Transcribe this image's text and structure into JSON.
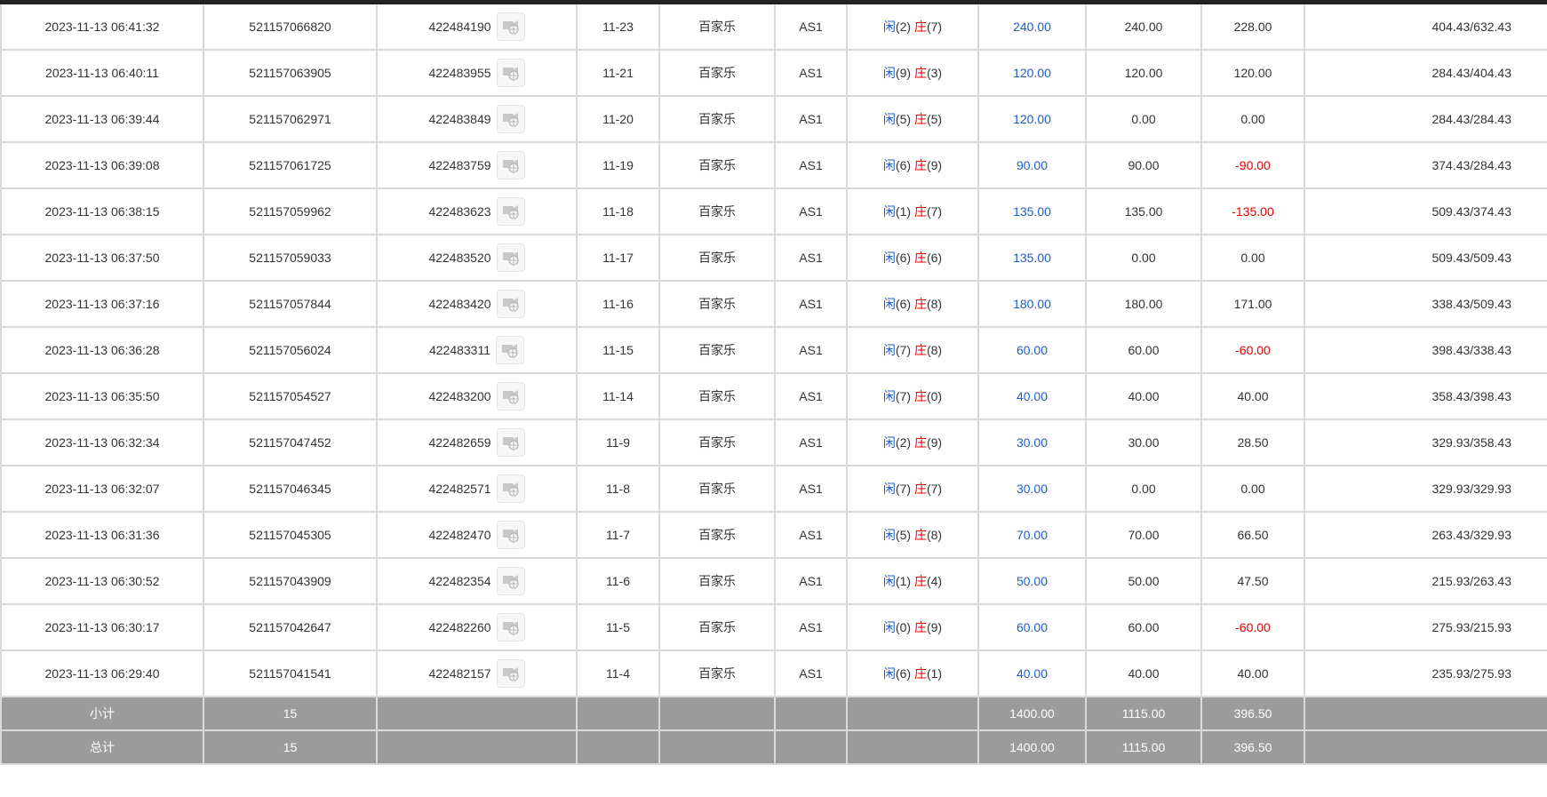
{
  "colors": {
    "bet_blue": "#1e5fc8",
    "loss_red": "#e60000",
    "footer_gray": "#9b9b9b"
  },
  "icons": {
    "video": "video-replay-icon"
  },
  "table": {
    "rows": [
      {
        "time": "2023-11-13 06:41:32",
        "order_no": "521157066820",
        "round_no": "422484190",
        "shoe": "11-23",
        "game": "百家乐",
        "table": "AS1",
        "player_label": "闲",
        "player_pts": "(2)",
        "banker_label": "庄",
        "banker_pts": "(7)",
        "bet": "240.00",
        "valid_bet": "240.00",
        "win_loss": "228.00",
        "win_loss_negative": false,
        "balance": "404.43/632.43"
      },
      {
        "time": "2023-11-13 06:40:11",
        "order_no": "521157063905",
        "round_no": "422483955",
        "shoe": "11-21",
        "game": "百家乐",
        "table": "AS1",
        "player_label": "闲",
        "player_pts": "(9)",
        "banker_label": "庄",
        "banker_pts": "(3)",
        "bet": "120.00",
        "valid_bet": "120.00",
        "win_loss": "120.00",
        "win_loss_negative": false,
        "balance": "284.43/404.43"
      },
      {
        "time": "2023-11-13 06:39:44",
        "order_no": "521157062971",
        "round_no": "422483849",
        "shoe": "11-20",
        "game": "百家乐",
        "table": "AS1",
        "player_label": "闲",
        "player_pts": "(5)",
        "banker_label": "庄",
        "banker_pts": "(5)",
        "bet": "120.00",
        "valid_bet": "0.00",
        "win_loss": "0.00",
        "win_loss_negative": false,
        "balance": "284.43/284.43"
      },
      {
        "time": "2023-11-13 06:39:08",
        "order_no": "521157061725",
        "round_no": "422483759",
        "shoe": "11-19",
        "game": "百家乐",
        "table": "AS1",
        "player_label": "闲",
        "player_pts": "(6)",
        "banker_label": "庄",
        "banker_pts": "(9)",
        "bet": "90.00",
        "valid_bet": "90.00",
        "win_loss": "-90.00",
        "win_loss_negative": true,
        "balance": "374.43/284.43"
      },
      {
        "time": "2023-11-13 06:38:15",
        "order_no": "521157059962",
        "round_no": "422483623",
        "shoe": "11-18",
        "game": "百家乐",
        "table": "AS1",
        "player_label": "闲",
        "player_pts": "(1)",
        "banker_label": "庄",
        "banker_pts": "(7)",
        "bet": "135.00",
        "valid_bet": "135.00",
        "win_loss": "-135.00",
        "win_loss_negative": true,
        "balance": "509.43/374.43"
      },
      {
        "time": "2023-11-13 06:37:50",
        "order_no": "521157059033",
        "round_no": "422483520",
        "shoe": "11-17",
        "game": "百家乐",
        "table": "AS1",
        "player_label": "闲",
        "player_pts": "(6)",
        "banker_label": "庄",
        "banker_pts": "(6)",
        "bet": "135.00",
        "valid_bet": "0.00",
        "win_loss": "0.00",
        "win_loss_negative": false,
        "balance": "509.43/509.43"
      },
      {
        "time": "2023-11-13 06:37:16",
        "order_no": "521157057844",
        "round_no": "422483420",
        "shoe": "11-16",
        "game": "百家乐",
        "table": "AS1",
        "player_label": "闲",
        "player_pts": "(6)",
        "banker_label": "庄",
        "banker_pts": "(8)",
        "bet": "180.00",
        "valid_bet": "180.00",
        "win_loss": "171.00",
        "win_loss_negative": false,
        "balance": "338.43/509.43"
      },
      {
        "time": "2023-11-13 06:36:28",
        "order_no": "521157056024",
        "round_no": "422483311",
        "shoe": "11-15",
        "game": "百家乐",
        "table": "AS1",
        "player_label": "闲",
        "player_pts": "(7)",
        "banker_label": "庄",
        "banker_pts": "(8)",
        "bet": "60.00",
        "valid_bet": "60.00",
        "win_loss": "-60.00",
        "win_loss_negative": true,
        "balance": "398.43/338.43"
      },
      {
        "time": "2023-11-13 06:35:50",
        "order_no": "521157054527",
        "round_no": "422483200",
        "shoe": "11-14",
        "game": "百家乐",
        "table": "AS1",
        "player_label": "闲",
        "player_pts": "(7)",
        "banker_label": "庄",
        "banker_pts": "(0)",
        "bet": "40.00",
        "valid_bet": "40.00",
        "win_loss": "40.00",
        "win_loss_negative": false,
        "balance": "358.43/398.43"
      },
      {
        "time": "2023-11-13 06:32:34",
        "order_no": "521157047452",
        "round_no": "422482659",
        "shoe": "11-9",
        "game": "百家乐",
        "table": "AS1",
        "player_label": "闲",
        "player_pts": "(2)",
        "banker_label": "庄",
        "banker_pts": "(9)",
        "bet": "30.00",
        "valid_bet": "30.00",
        "win_loss": "28.50",
        "win_loss_negative": false,
        "balance": "329.93/358.43"
      },
      {
        "time": "2023-11-13 06:32:07",
        "order_no": "521157046345",
        "round_no": "422482571",
        "shoe": "11-8",
        "game": "百家乐",
        "table": "AS1",
        "player_label": "闲",
        "player_pts": "(7)",
        "banker_label": "庄",
        "banker_pts": "(7)",
        "bet": "30.00",
        "valid_bet": "0.00",
        "win_loss": "0.00",
        "win_loss_negative": false,
        "balance": "329.93/329.93"
      },
      {
        "time": "2023-11-13 06:31:36",
        "order_no": "521157045305",
        "round_no": "422482470",
        "shoe": "11-7",
        "game": "百家乐",
        "table": "AS1",
        "player_label": "闲",
        "player_pts": "(5)",
        "banker_label": "庄",
        "banker_pts": "(8)",
        "bet": "70.00",
        "valid_bet": "70.00",
        "win_loss": "66.50",
        "win_loss_negative": false,
        "balance": "263.43/329.93"
      },
      {
        "time": "2023-11-13 06:30:52",
        "order_no": "521157043909",
        "round_no": "422482354",
        "shoe": "11-6",
        "game": "百家乐",
        "table": "AS1",
        "player_label": "闲",
        "player_pts": "(1)",
        "banker_label": "庄",
        "banker_pts": "(4)",
        "bet": "50.00",
        "valid_bet": "50.00",
        "win_loss": "47.50",
        "win_loss_negative": false,
        "balance": "215.93/263.43"
      },
      {
        "time": "2023-11-13 06:30:17",
        "order_no": "521157042647",
        "round_no": "422482260",
        "shoe": "11-5",
        "game": "百家乐",
        "table": "AS1",
        "player_label": "闲",
        "player_pts": "(0)",
        "banker_label": "庄",
        "banker_pts": "(9)",
        "bet": "60.00",
        "valid_bet": "60.00",
        "win_loss": "-60.00",
        "win_loss_negative": true,
        "balance": "275.93/215.93"
      },
      {
        "time": "2023-11-13 06:29:40",
        "order_no": "521157041541",
        "round_no": "422482157",
        "shoe": "11-4",
        "game": "百家乐",
        "table": "AS1",
        "player_label": "闲",
        "player_pts": "(6)",
        "banker_label": "庄",
        "banker_pts": "(1)",
        "bet": "40.00",
        "valid_bet": "40.00",
        "win_loss": "40.00",
        "win_loss_negative": false,
        "balance": "235.93/275.93"
      }
    ],
    "subtotal": {
      "label": "小计",
      "count": "15",
      "bet": "1400.00",
      "valid_bet": "1115.00",
      "win_loss": "396.50"
    },
    "total": {
      "label": "总计",
      "count": "15",
      "bet": "1400.00",
      "valid_bet": "1115.00",
      "win_loss": "396.50"
    }
  }
}
